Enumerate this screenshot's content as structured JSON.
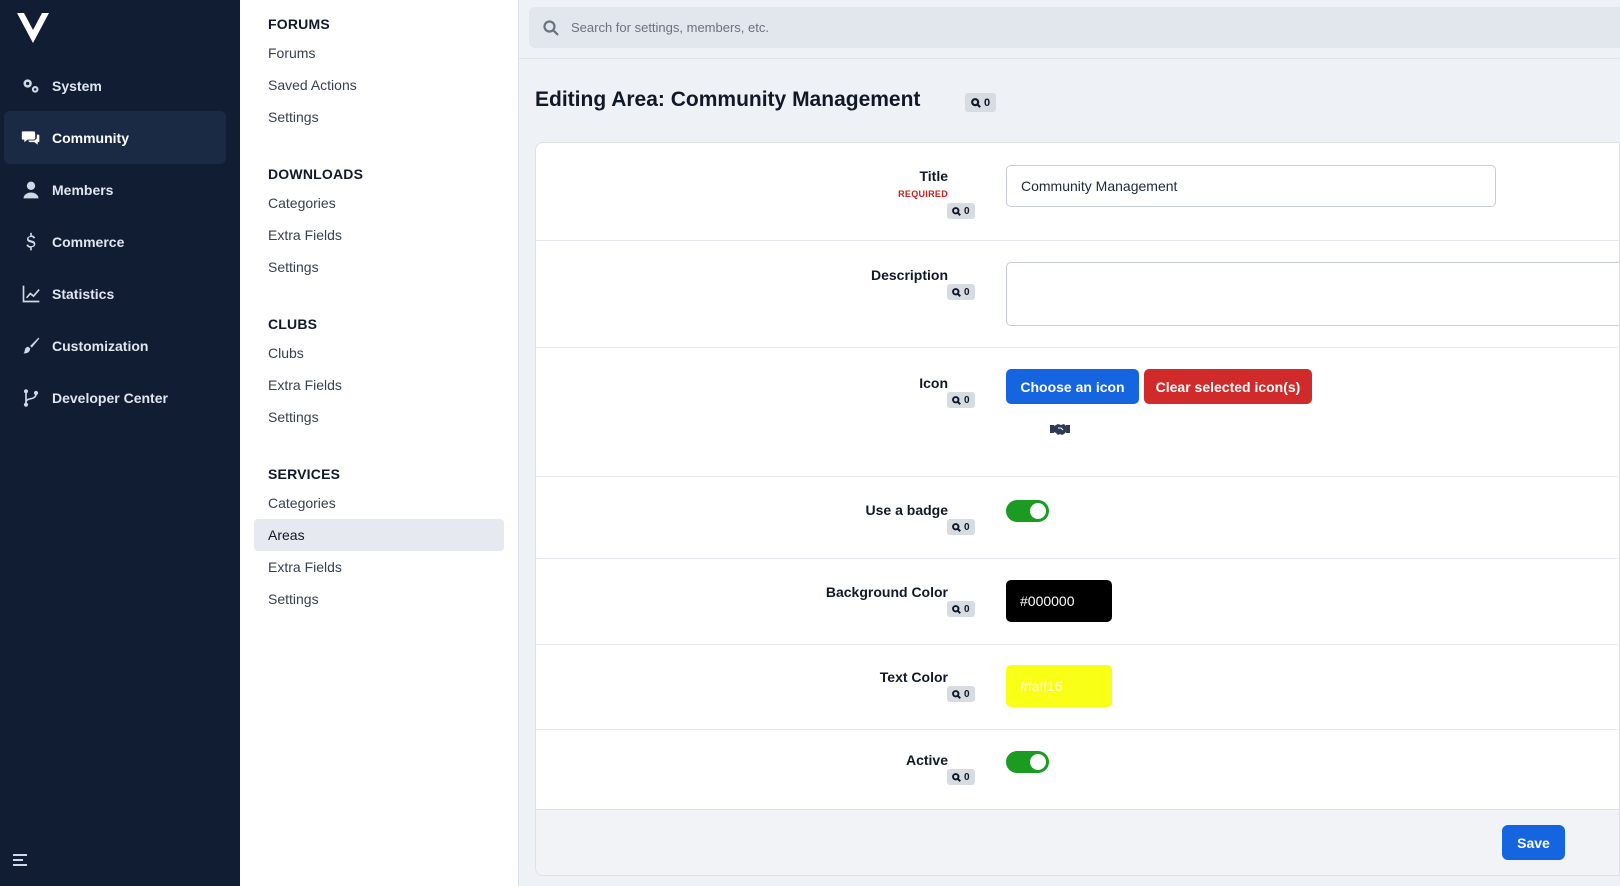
{
  "nav": {
    "items": [
      {
        "label": "System",
        "icon": "gears-icon"
      },
      {
        "label": "Community",
        "icon": "comments-icon",
        "active": true
      },
      {
        "label": "Members",
        "icon": "user-icon"
      },
      {
        "label": "Commerce",
        "icon": "dollar-icon"
      },
      {
        "label": "Statistics",
        "icon": "chart-line-icon"
      },
      {
        "label": "Customization",
        "icon": "brush-icon"
      },
      {
        "label": "Developer Center",
        "icon": "code-branch-icon"
      }
    ]
  },
  "subnav": {
    "sections": [
      {
        "title": "FORUMS",
        "items": [
          "Forums",
          "Saved Actions",
          "Settings"
        ]
      },
      {
        "title": "DOWNLOADS",
        "items": [
          "Categories",
          "Extra Fields",
          "Settings"
        ]
      },
      {
        "title": "CLUBS",
        "items": [
          "Clubs",
          "Extra Fields",
          "Settings"
        ]
      },
      {
        "title": "SERVICES",
        "items": [
          "Categories",
          "Areas",
          "Extra Fields",
          "Settings"
        ]
      }
    ],
    "active": "Areas"
  },
  "search": {
    "placeholder": "Search for settings, members, etc."
  },
  "page": {
    "title": "Editing Area: Community Management",
    "badge_count": "0"
  },
  "form": {
    "title_label": "Title",
    "required_label": "REQUIRED",
    "title_value": "Community Management",
    "description_label": "Description",
    "icon_label": "Icon",
    "choose_icon_label": "Choose an icon",
    "clear_icon_label": "Clear selected icon(s)",
    "selected_icon": "handshake-icon",
    "badge_label": "Use a badge",
    "badge_enabled": true,
    "bg_color_label": "Background Color",
    "bg_color_value": "#000000",
    "text_color_label": "Text Color",
    "text_color_value": "#faff16",
    "active_label": "Active",
    "active_enabled": true,
    "field_badge_count": "0",
    "save_label": "Save"
  },
  "colors": {
    "nav_bg": "#101d33",
    "primary": "#1565e0",
    "danger": "#d02a2a",
    "toggle_on": "#1c9b22",
    "bg_color_swatch": "#000000",
    "text_color_swatch": "#faff16"
  }
}
